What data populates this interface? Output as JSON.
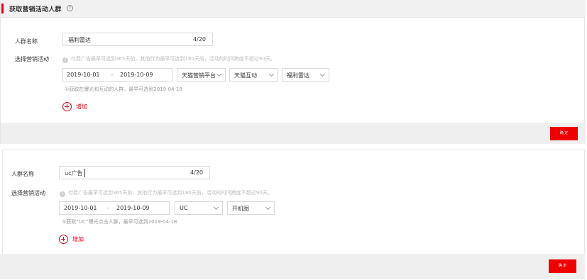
{
  "panel1": {
    "title": "获取营销活动人群",
    "help_glyph": "?",
    "name_label": "人群名称",
    "name_value": "福利雷达",
    "name_count": "4/20",
    "activity_label": "选择营销活动",
    "info_glyph": "!",
    "info_text": "付费广告最早可选到365天前，其他行为最早可选到180天前，活动的时间跨度不超过90天。",
    "date_start": "2019-10-01",
    "date_sep": "–",
    "date_end": "2019-10-09",
    "selects": [
      "天猫营销平台",
      "天猫互动",
      "福利雷达"
    ],
    "hint": "①获取在曝光和互动的人群，最早可选到2019-04-18",
    "add_label": "增加",
    "button_label": "确 定"
  },
  "panel2": {
    "name_label": "人群名称",
    "name_value": "uc广告",
    "name_count": "4/20",
    "activity_label": "选择营销活动",
    "info_glyph": "!",
    "info_text": "付费广告最早可选到365天前，其他行为最早可选到180天前，活动的时间跨度不超过90天。",
    "date_start": "2019-10-01",
    "date_sep": "–",
    "date_end": "2019-10-09",
    "selects": [
      "UC",
      "开机图"
    ],
    "hint": "①获取“UC”曝光点击人群，最早可选到2019-04-18",
    "add_label": "增加",
    "button_label": "确 定"
  },
  "colors": {
    "accent": "#e60012",
    "button": "#ee0000",
    "footer": "#efefef",
    "titlebar": "#f1f1f1"
  }
}
